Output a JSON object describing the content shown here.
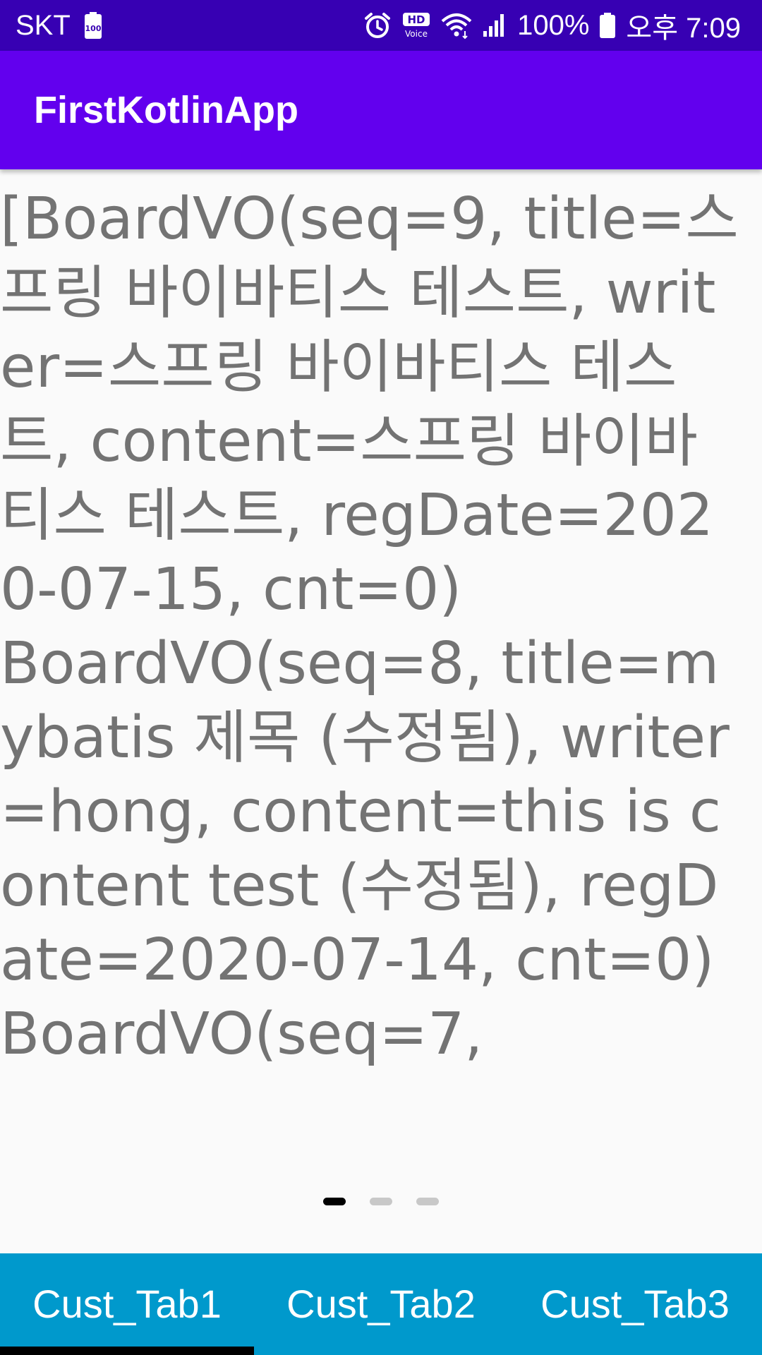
{
  "status_bar": {
    "carrier": "SKT",
    "battery_small": "100",
    "battery_percent": "100%",
    "time": "오후 7:09",
    "hd_badge_top": "HD",
    "hd_badge_bottom": "Voice",
    "icons": [
      "sim-battery-icon",
      "alarm-icon",
      "hd-voice-icon",
      "wifi-icon",
      "signal-icon",
      "battery-icon"
    ]
  },
  "app_bar": {
    "title": "FirstKotlinApp"
  },
  "content": {
    "text": "[BoardVO(seq=9, title=스프링 바이바티스 테스트, writer=스프링 바이바티스 테스트, content=스프링 바이바티스 테스트, regDate=2020-07-15, cnt=0)\nBoardVO(seq=8, title=mybatis 제목 (수정됨), writer=hong, content=this is content test (수정됨), regDate=2020-07-14, cnt=0)\nBoardVO(seq=7,"
  },
  "page_indicator": {
    "count": 3,
    "active_index": 0
  },
  "tabs": [
    {
      "label": "Cust_Tab1",
      "selected": true
    },
    {
      "label": "Cust_Tab2",
      "selected": false
    },
    {
      "label": "Cust_Tab3",
      "selected": false
    }
  ],
  "colors": {
    "status_bar": "#3700b3",
    "app_bar": "#6200ee",
    "tab_bar": "#0099cc",
    "tab_indicator": "#000000",
    "content_text": "#737373",
    "background": "#fafafa"
  }
}
